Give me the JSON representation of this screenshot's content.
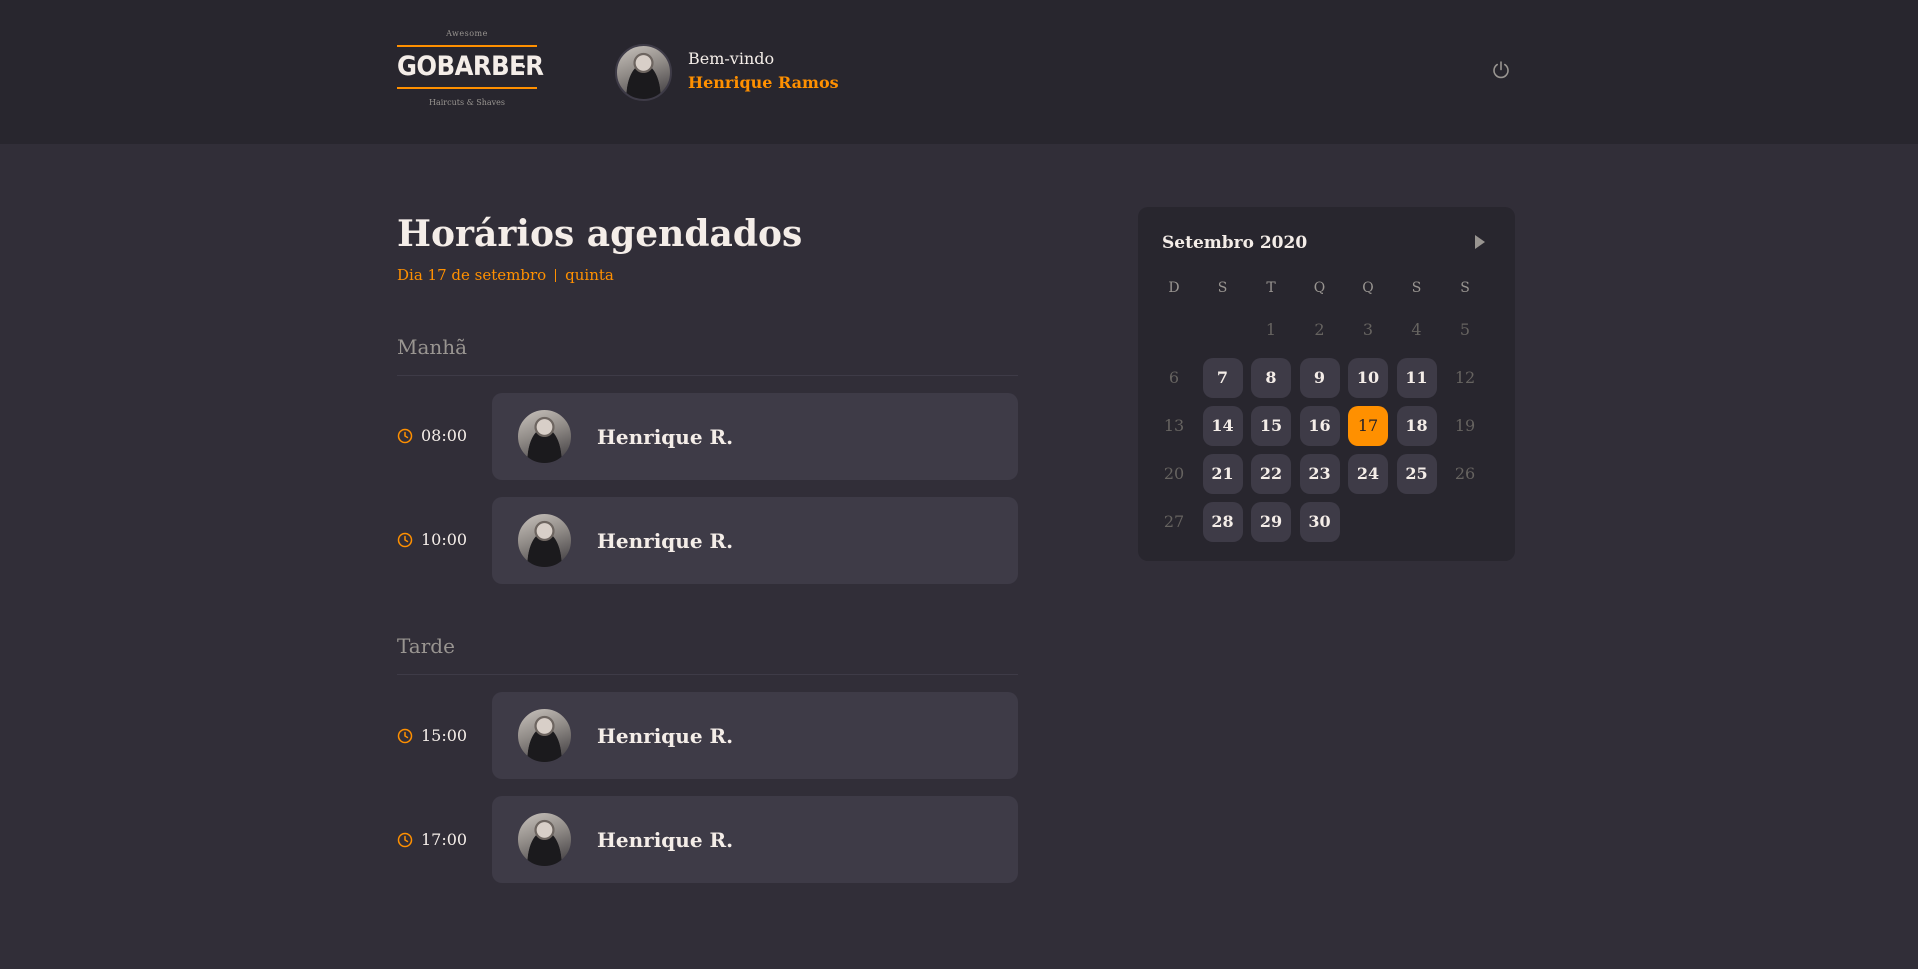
{
  "header": {
    "logo": {
      "top": "Awesome",
      "brand": "GOBARBER",
      "bottom": "Haircuts & Shaves"
    },
    "welcome": "Bem-vindo",
    "user_name": "Henrique Ramos",
    "power_icon": "power-icon"
  },
  "schedule": {
    "title": "Horários agendados",
    "day_label": "Dia 17 de setembro",
    "weekday_label": "quinta",
    "morning_title": "Manhã",
    "afternoon_title": "Tarde",
    "morning": [
      {
        "time": "08:00",
        "name": "Henrique R."
      },
      {
        "time": "10:00",
        "name": "Henrique R."
      }
    ],
    "afternoon": [
      {
        "time": "15:00",
        "name": "Henrique R."
      },
      {
        "time": "17:00",
        "name": "Henrique R."
      }
    ]
  },
  "calendar": {
    "month_label": "Setembro 2020",
    "weekdays": [
      "D",
      "S",
      "T",
      "Q",
      "Q",
      "S",
      "S"
    ],
    "selected_day": "17",
    "weeks": [
      [
        "",
        "",
        "1",
        "2",
        "3",
        "4",
        "5"
      ],
      [
        "6",
        "7",
        "8",
        "9",
        "10",
        "11",
        "12"
      ],
      [
        "13",
        "14",
        "15",
        "16",
        "17",
        "18",
        "19"
      ],
      [
        "20",
        "21",
        "22",
        "23",
        "24",
        "25",
        "26"
      ],
      [
        "27",
        "28",
        "29",
        "30",
        "",
        "",
        ""
      ]
    ],
    "available_days": [
      "7",
      "8",
      "9",
      "10",
      "11",
      "14",
      "15",
      "16",
      "17",
      "18",
      "21",
      "22",
      "23",
      "24",
      "25",
      "28",
      "29",
      "30"
    ]
  },
  "colors": {
    "accent": "#ff9000",
    "background": "#312e38",
    "header_bg": "#28262e",
    "card_bg": "#3e3b47",
    "text": "#f4ede8",
    "muted": "#999591"
  }
}
